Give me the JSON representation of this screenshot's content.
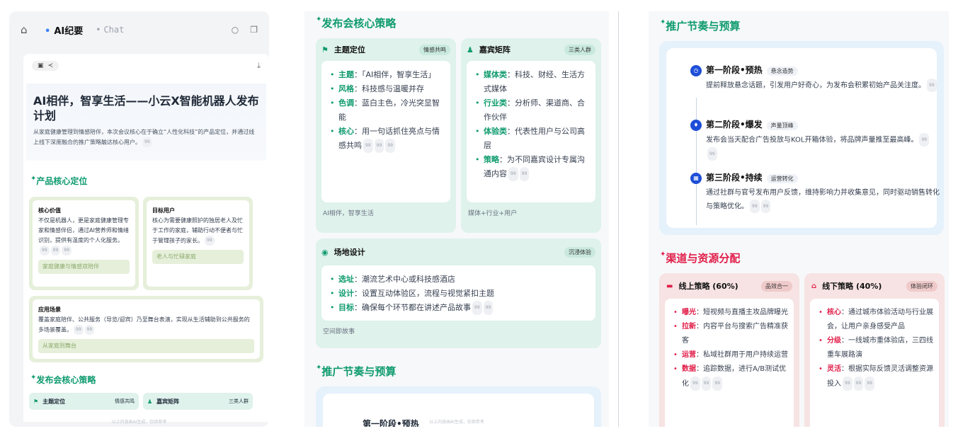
{
  "nav": {
    "tab_ai": "AI纪要",
    "tab_chat": "Chat"
  },
  "doc": {
    "title": "AI相伴，智享生活——小云X智能机器人发布计划",
    "summary": "从家庭健康管理到情感陪伴，本次会议核心在于确立“人性化科技”的产品定位，并通过线上线下深度融合的推广策略触达核心用户。",
    "footnote": "以上内容由AI生成，仅供参考",
    "cite": "99"
  },
  "positioning": {
    "heading": "产品核心定位",
    "value": {
      "title": "核心价值",
      "text": "不仅是机器人，更是家庭健康管理专家和情感伴侣，通过AI营养师和情绪识别，提供有温度的个人化服务。",
      "tag": "家庭健康与情感双陪伴"
    },
    "users": {
      "title": "目标用户",
      "text": "核心为需要健康照护的独居老人及忙于工作的家庭，辅助行动不便者与忙于管理孩子的家长。",
      "tag": "老人与忙碌家庭"
    },
    "scenes": {
      "title": "应用场景",
      "text": "覆盖家庭陪伴、公共服务（导览/迎宾）乃至舞台表演，实现从生活辅助到公共服务的多场景覆盖。",
      "tag": "从家庭到舞台"
    }
  },
  "launch": {
    "heading": "发布会核心策略",
    "theme": {
      "title": "主题定位",
      "badge": "情感共鸣",
      "items": [
        {
          "k": "主题",
          "v": "：「AI相伴，智享生活」"
        },
        {
          "k": "风格",
          "v": "：科技感与温暖并存"
        },
        {
          "k": "色调",
          "v": "：蓝白主色，冷光突显智能"
        },
        {
          "k": "核心",
          "v": "：用一句话抓住亮点与情感共鸣"
        }
      ],
      "foot": "AI相伴，智享生活"
    },
    "guests": {
      "title": "嘉宾矩阵",
      "badge": "三类人群",
      "items": [
        {
          "k": "媒体类",
          "v": "：科技、财经、生活方式媒体"
        },
        {
          "k": "行业类",
          "v": "：分析师、渠道商、合作伙伴"
        },
        {
          "k": "体验类",
          "v": "：代表性用户与公司高层"
        },
        {
          "k": "策略",
          "v": "：为不同嘉宾设计专属沟通内容"
        }
      ],
      "foot": "媒体+行业+用户"
    },
    "venue": {
      "title": "场地设计",
      "badge": "沉浸体验",
      "items": [
        {
          "k": "选址",
          "v": "：潮流艺术中心或科技感酒店"
        },
        {
          "k": "设计",
          "v": "：设置互动体验区，流程与视觉紧扣主题"
        },
        {
          "k": "目标",
          "v": "：确保每个环节都在讲述产品故事"
        }
      ],
      "foot": "空间即故事"
    }
  },
  "rhythm": {
    "heading": "推广节奏与预算",
    "stages": [
      {
        "title": "第一阶段•预热",
        "badge": "悬念造势",
        "text": "提前释放悬念话题，引发用户好奇心，为发布会积累初始产品关注度。"
      },
      {
        "title": "第二阶段•爆发",
        "badge": "声量顶峰",
        "text": "发布会当天配合广告投放与KOL开箱体验，将品牌声量推至最高峰。"
      },
      {
        "title": "第三阶段•持续",
        "badge": "运营转化",
        "text": "通过社群与官号发布用户反馈，维持影响力并收集意见，同时驱动销售转化与策略优化。"
      }
    ]
  },
  "channels": {
    "heading": "渠道与资源分配",
    "online": {
      "title": "线上策略 (60%)",
      "badge": "品效合一",
      "items": [
        {
          "k": "曝光",
          "v": "：短视频与直播主攻品牌曝光"
        },
        {
          "k": "拉新",
          "v": "：内容平台与搜索广告精准获客"
        },
        {
          "k": "运营",
          "v": "：私域社群用于用户持续运营"
        },
        {
          "k": "数据",
          "v": "：追踪数据，进行A/B测试优化"
        }
      ]
    },
    "offline": {
      "title": "线下策略 (40%)",
      "badge": "体验闭环",
      "items": [
        {
          "k": "核心",
          "v": "：通过城市体验活动与行业展会，让用户亲身感受产品"
        },
        {
          "k": "分级",
          "v": "：一线城市重体验店，三四线重车展路演"
        },
        {
          "k": "灵活",
          "v": "：根据实际反馈灵活调整资源投入"
        }
      ]
    }
  }
}
